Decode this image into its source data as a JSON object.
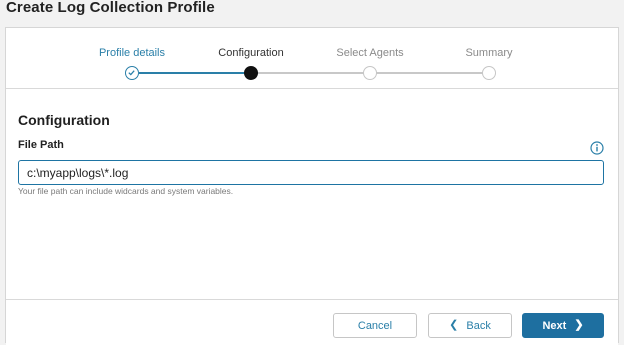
{
  "header": {
    "title": "Create Log Collection Profile"
  },
  "stepper": {
    "steps": [
      {
        "label": "Profile details",
        "state": "completed"
      },
      {
        "label": "Configuration",
        "state": "active"
      },
      {
        "label": "Select Agents",
        "state": "pending"
      },
      {
        "label": "Summary",
        "state": "pending"
      }
    ]
  },
  "form": {
    "section_title": "Configuration",
    "file_path_label": "File Path",
    "file_path_value": "c:\\myapp\\logs\\*.log",
    "help_text": "Your file path can include widcards and system variables."
  },
  "footer": {
    "cancel_label": "Cancel",
    "back_label": "Back",
    "next_label": "Next"
  },
  "colors": {
    "accent": "#2a7fa8",
    "primary_button": "#1e6fa0",
    "active_step": "#111111",
    "pending_step": "#c6c6c6"
  }
}
